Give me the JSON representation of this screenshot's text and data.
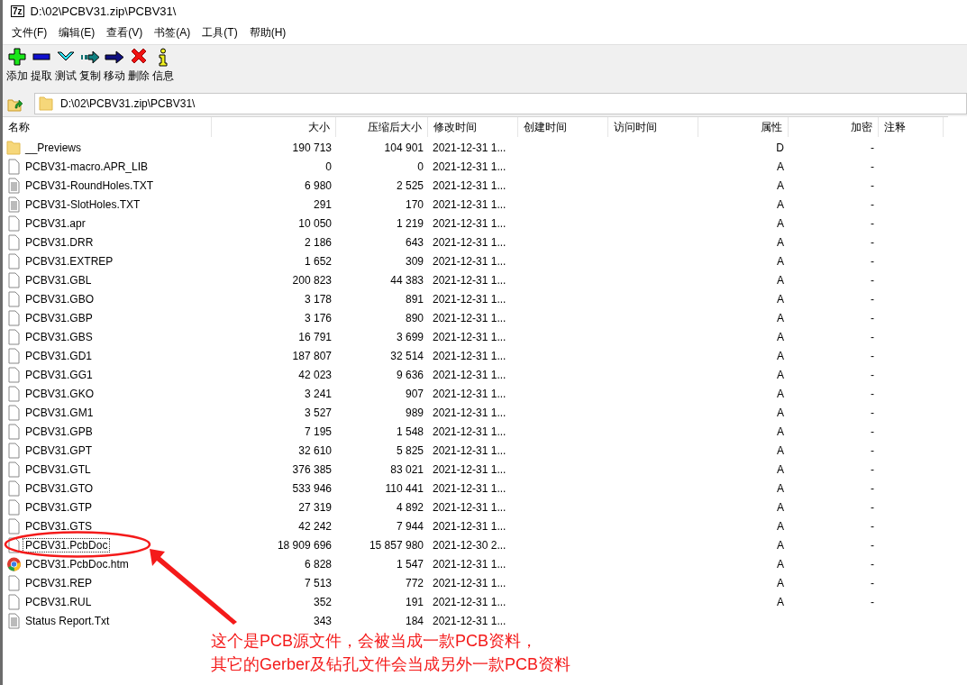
{
  "window": {
    "icon_text": "7z",
    "title": "D:\\02\\PCBV31.zip\\PCBV31\\"
  },
  "menu": [
    "文件(F)",
    "编辑(E)",
    "查看(V)",
    "书签(A)",
    "工具(T)",
    "帮助(H)"
  ],
  "toolbar": [
    {
      "kind": "add",
      "label": "添加"
    },
    {
      "kind": "extract",
      "label": "提取"
    },
    {
      "kind": "test",
      "label": "测试"
    },
    {
      "kind": "copy",
      "label": "复制"
    },
    {
      "kind": "move",
      "label": "移动"
    },
    {
      "kind": "delete",
      "label": "删除"
    },
    {
      "kind": "info",
      "label": "信息"
    }
  ],
  "address": {
    "value": "D:\\02\\PCBV31.zip\\PCBV31\\"
  },
  "columns": [
    "名称",
    "大小",
    "压缩后大小",
    "修改时间",
    "创建时间",
    "访问时间",
    "属性",
    "加密",
    "注释"
  ],
  "rows": [
    {
      "kind": "folder",
      "name": "__Previews",
      "size": "190 713",
      "packed": "104 901",
      "modified": "2021-12-31 1...",
      "attributes": "D",
      "encrypted": "-",
      "focused": false
    },
    {
      "kind": "file",
      "name": "PCBV31-macro.APR_LIB",
      "size": "0",
      "packed": "0",
      "modified": "2021-12-31 1...",
      "attributes": "A",
      "encrypted": "-",
      "focused": false
    },
    {
      "kind": "text",
      "name": "PCBV31-RoundHoles.TXT",
      "size": "6 980",
      "packed": "2 525",
      "modified": "2021-12-31 1...",
      "attributes": "A",
      "encrypted": "-",
      "focused": false
    },
    {
      "kind": "text",
      "name": "PCBV31-SlotHoles.TXT",
      "size": "291",
      "packed": "170",
      "modified": "2021-12-31 1...",
      "attributes": "A",
      "encrypted": "-",
      "focused": false
    },
    {
      "kind": "file",
      "name": "PCBV31.apr",
      "size": "10 050",
      "packed": "1 219",
      "modified": "2021-12-31 1...",
      "attributes": "A",
      "encrypted": "-",
      "focused": false
    },
    {
      "kind": "file",
      "name": "PCBV31.DRR",
      "size": "2 186",
      "packed": "643",
      "modified": "2021-12-31 1...",
      "attributes": "A",
      "encrypted": "-",
      "focused": false
    },
    {
      "kind": "file",
      "name": "PCBV31.EXTREP",
      "size": "1 652",
      "packed": "309",
      "modified": "2021-12-31 1...",
      "attributes": "A",
      "encrypted": "-",
      "focused": false
    },
    {
      "kind": "file",
      "name": "PCBV31.GBL",
      "size": "200 823",
      "packed": "44 383",
      "modified": "2021-12-31 1...",
      "attributes": "A",
      "encrypted": "-",
      "focused": false
    },
    {
      "kind": "file",
      "name": "PCBV31.GBO",
      "size": "3 178",
      "packed": "891",
      "modified": "2021-12-31 1...",
      "attributes": "A",
      "encrypted": "-",
      "focused": false
    },
    {
      "kind": "file",
      "name": "PCBV31.GBP",
      "size": "3 176",
      "packed": "890",
      "modified": "2021-12-31 1...",
      "attributes": "A",
      "encrypted": "-",
      "focused": false
    },
    {
      "kind": "file",
      "name": "PCBV31.GBS",
      "size": "16 791",
      "packed": "3 699",
      "modified": "2021-12-31 1...",
      "attributes": "A",
      "encrypted": "-",
      "focused": false
    },
    {
      "kind": "file",
      "name": "PCBV31.GD1",
      "size": "187 807",
      "packed": "32 514",
      "modified": "2021-12-31 1...",
      "attributes": "A",
      "encrypted": "-",
      "focused": false
    },
    {
      "kind": "file",
      "name": "PCBV31.GG1",
      "size": "42 023",
      "packed": "9 636",
      "modified": "2021-12-31 1...",
      "attributes": "A",
      "encrypted": "-",
      "focused": false
    },
    {
      "kind": "file",
      "name": "PCBV31.GKO",
      "size": "3 241",
      "packed": "907",
      "modified": "2021-12-31 1...",
      "attributes": "A",
      "encrypted": "-",
      "focused": false
    },
    {
      "kind": "file",
      "name": "PCBV31.GM1",
      "size": "3 527",
      "packed": "989",
      "modified": "2021-12-31 1...",
      "attributes": "A",
      "encrypted": "-",
      "focused": false
    },
    {
      "kind": "file",
      "name": "PCBV31.GPB",
      "size": "7 195",
      "packed": "1 548",
      "modified": "2021-12-31 1...",
      "attributes": "A",
      "encrypted": "-",
      "focused": false
    },
    {
      "kind": "file",
      "name": "PCBV31.GPT",
      "size": "32 610",
      "packed": "5 825",
      "modified": "2021-12-31 1...",
      "attributes": "A",
      "encrypted": "-",
      "focused": false
    },
    {
      "kind": "file",
      "name": "PCBV31.GTL",
      "size": "376 385",
      "packed": "83 021",
      "modified": "2021-12-31 1...",
      "attributes": "A",
      "encrypted": "-",
      "focused": false
    },
    {
      "kind": "file",
      "name": "PCBV31.GTO",
      "size": "533 946",
      "packed": "110 441",
      "modified": "2021-12-31 1...",
      "attributes": "A",
      "encrypted": "-",
      "focused": false
    },
    {
      "kind": "file",
      "name": "PCBV31.GTP",
      "size": "27 319",
      "packed": "4 892",
      "modified": "2021-12-31 1...",
      "attributes": "A",
      "encrypted": "-",
      "focused": false
    },
    {
      "kind": "file",
      "name": "PCBV31.GTS",
      "size": "42 242",
      "packed": "7 944",
      "modified": "2021-12-31 1...",
      "attributes": "A",
      "encrypted": "-",
      "focused": false
    },
    {
      "kind": "file",
      "name": "PCBV31.PcbDoc",
      "size": "18 909 696",
      "packed": "15 857 980",
      "modified": "2021-12-30 2...",
      "attributes": "A",
      "encrypted": "-",
      "focused": true
    },
    {
      "kind": "browser",
      "name": "PCBV31.PcbDoc.htm",
      "size": "6 828",
      "packed": "1 547",
      "modified": "2021-12-31 1...",
      "attributes": "A",
      "encrypted": "-",
      "focused": false
    },
    {
      "kind": "file",
      "name": "PCBV31.REP",
      "size": "7 513",
      "packed": "772",
      "modified": "2021-12-31 1...",
      "attributes": "A",
      "encrypted": "-",
      "focused": false
    },
    {
      "kind": "file",
      "name": "PCBV31.RUL",
      "size": "352",
      "packed": "191",
      "modified": "2021-12-31 1...",
      "attributes": "A",
      "encrypted": "-",
      "focused": false
    },
    {
      "kind": "text",
      "name": "Status Report.Txt",
      "size": "343",
      "packed": "184",
      "modified": "2021-12-31 1...",
      "focused": false
    }
  ],
  "annotation": {
    "lines": [
      "这个是PCB源文件，会被当成一款PCB资料，",
      "其它的Gerber及钻孔文件会当成另外一款PCB资料"
    ]
  }
}
